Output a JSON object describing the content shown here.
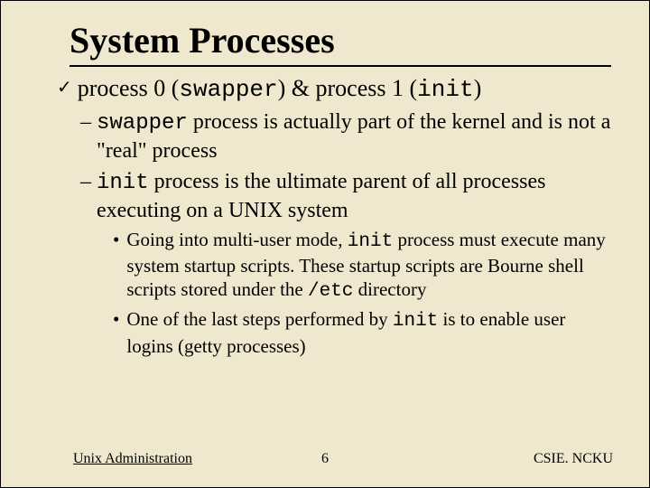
{
  "title": "System Processes",
  "b1": {
    "pre": "process 0 (",
    "code1": "swapper",
    "mid": ") & process 1 (",
    "code2": "init",
    "post": ")"
  },
  "b2a": {
    "code": "swapper",
    "text": " process is actually part of the kernel and is not a \"real\" process"
  },
  "b2b": {
    "code": "init",
    "text": " process is the ultimate parent of all processes executing on a UNIX system"
  },
  "b3a": {
    "pre": "Going into multi-user mode, ",
    "code1": "init",
    "mid": " process must execute many system startup scripts.  These startup scripts are Bourne shell scripts stored under the ",
    "code2": "/etc",
    "post": " directory"
  },
  "b3b": {
    "pre": "One of the last steps performed by ",
    "code": "init",
    "post": " is to enable user logins (getty processes)"
  },
  "footer": {
    "left": "Unix Administration",
    "center": "6",
    "right": "CSIE. NCKU"
  }
}
